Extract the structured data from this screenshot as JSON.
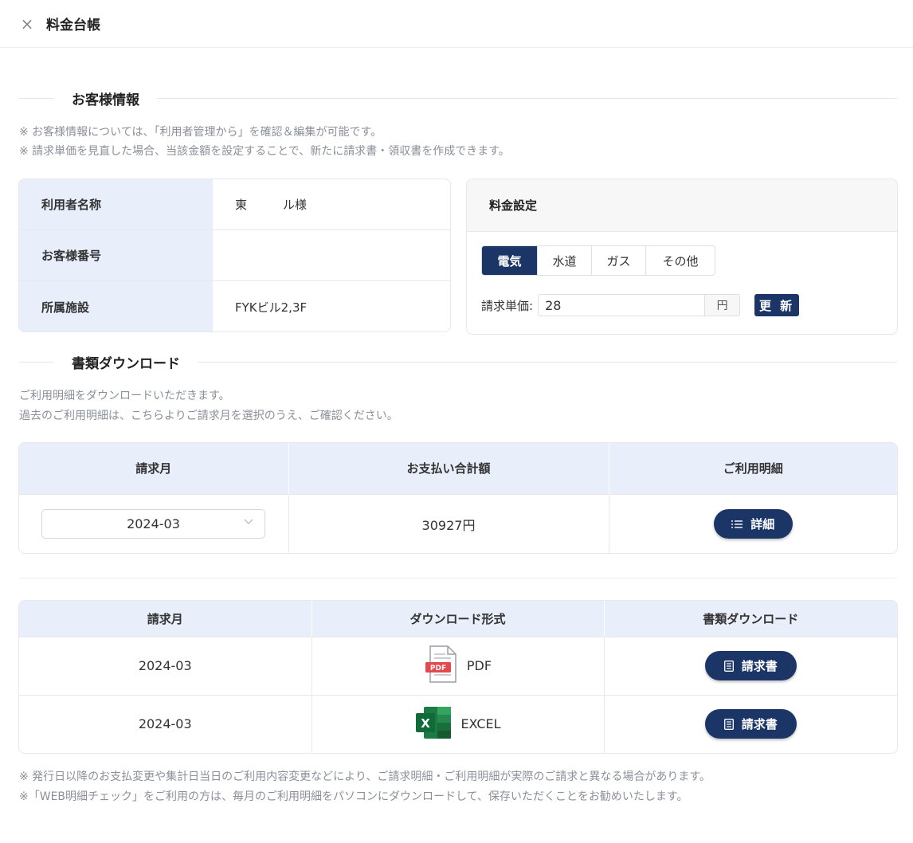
{
  "header": {
    "close_icon": "×",
    "title": "料金台帳"
  },
  "customer_section": {
    "title": "お客様情報",
    "notes": [
      "※ お客様情報については、「利用者管理から」を確認＆編集が可能です。",
      "※ 請求単価を見直した場合、当該金額を設定することで、新たに請求書・領収書を作成できます。"
    ],
    "info": {
      "rows": [
        {
          "label": "利用者名称",
          "value": "東　　　ル様"
        },
        {
          "label": "お客様番号",
          "value": ""
        },
        {
          "label": "所属施設",
          "value": "FYKビル2,3F"
        }
      ]
    },
    "fee": {
      "title": "料金設定",
      "tabs": [
        "電気",
        "水道",
        "ガス",
        "その他"
      ],
      "active_tab": "電気",
      "price_label": "請求単価:",
      "price_value": "28",
      "unit": "円",
      "update_label": "更 新"
    }
  },
  "download_section": {
    "title": "書類ダウンロード",
    "notes": [
      "ご利用明細をダウンロードいただきます。",
      "過去のご利用明細は、こちらよりご請求月を選択のうえ、ご確認ください。"
    ],
    "summary_table": {
      "headers": [
        "請求月",
        "お支払い合計額",
        "ご利用明細"
      ],
      "month": "2024-03",
      "total": "30927円",
      "detail_label": "詳細"
    },
    "documents_table": {
      "headers": [
        "請求月",
        "ダウンロード形式",
        "書類ダウンロード"
      ],
      "rows": [
        {
          "month": "2024-03",
          "format": "PDF",
          "icon": "pdf-file-icon",
          "button": "請求書"
        },
        {
          "month": "2024-03",
          "format": "EXCEL",
          "icon": "excel-file-icon",
          "button": "請求書"
        }
      ]
    },
    "footer_notes": [
      "※ 発行日以降のお支払変更や集計日当日のご利用内容変更などにより、ご請求明細・ご利用明細が実際のご請求と異なる場合があります。",
      "※「WEB明細チェック」をご利用の方は、毎月のご利用明細をパソコンにダウンロードして、保存いただくことをお勧めいたします。"
    ]
  },
  "colors": {
    "navy": "#1b3566",
    "header_blue": "#e9eefb",
    "note_gray": "#8a8f99",
    "pdf_red": "#e5484d",
    "excel_green": "#1e7a45"
  }
}
